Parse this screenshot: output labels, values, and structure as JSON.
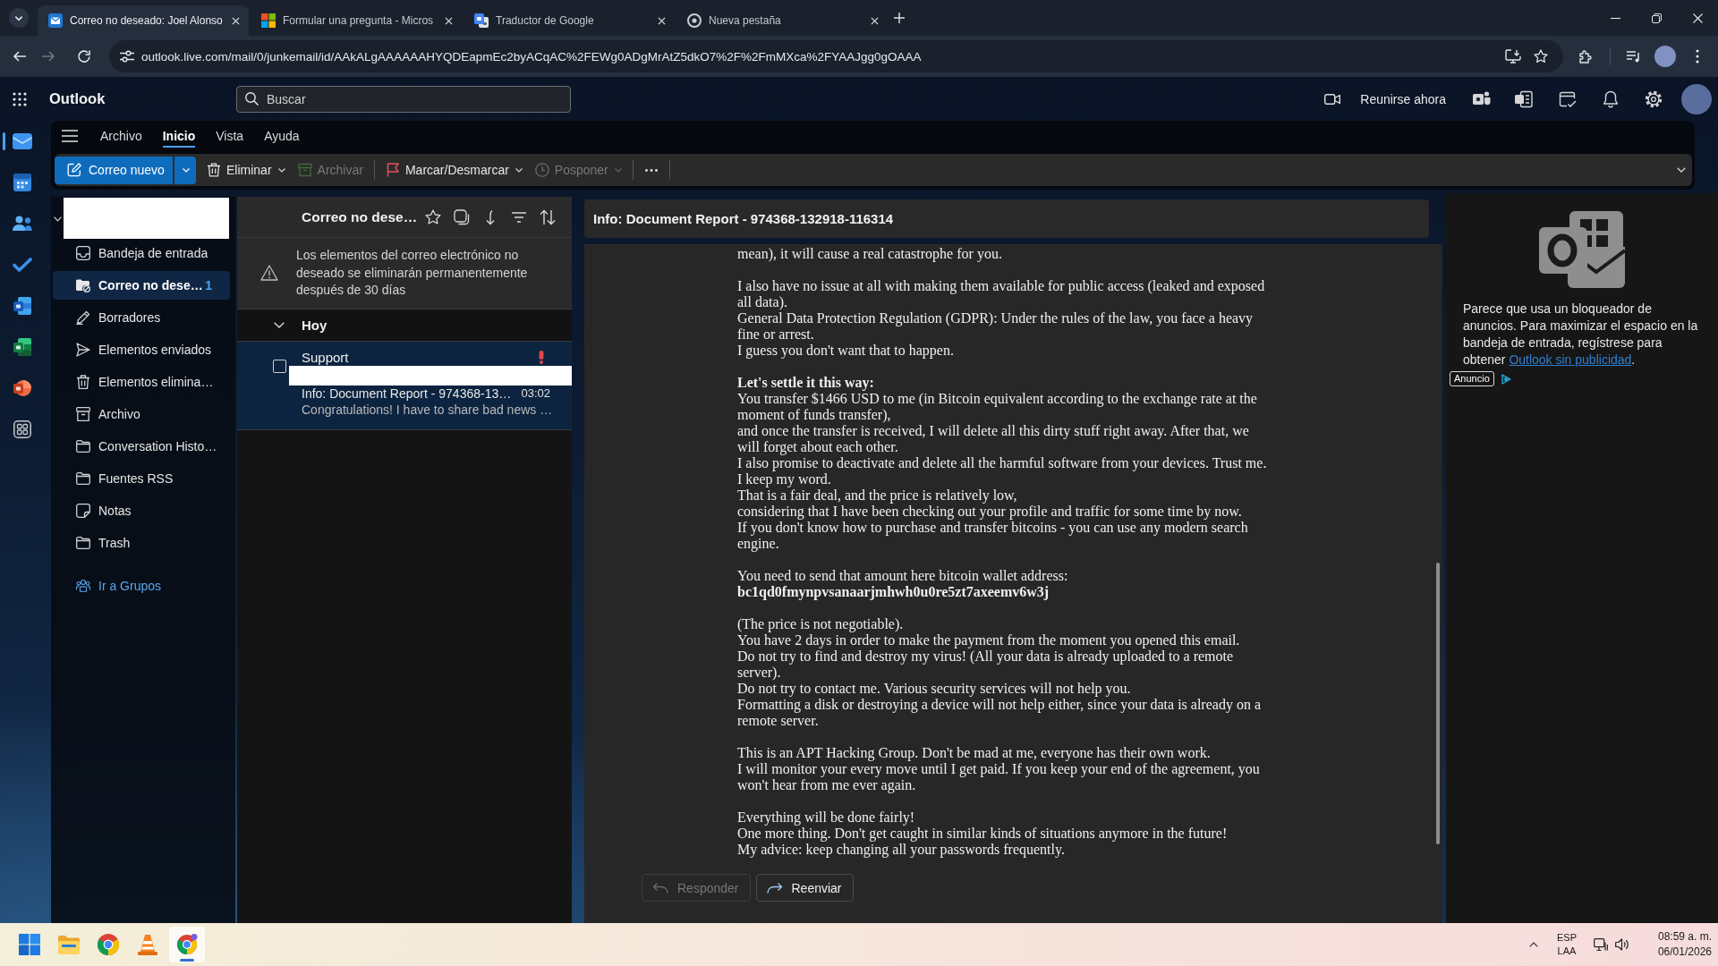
{
  "browser": {
    "tabs": [
      {
        "kind": "outlook",
        "title": "Correo no deseado: Joel Alonso",
        "selected": true
      },
      {
        "kind": "microsoft",
        "title": "Formular una pregunta - Micros",
        "selected": false
      },
      {
        "kind": "translate",
        "title": "Traductor de Google",
        "selected": false
      },
      {
        "kind": "newtab",
        "title": "Nueva pestaña",
        "selected": false
      }
    ],
    "address": "outlook.live.com/mail/0/junkemail/id/AAkALgAAAAAAHYQDEapmEc2byACqAC%2FEWg0ADgMrAtZ5dkO7%2F%2FmMXca%2FYAAJgg0gOAAA"
  },
  "header": {
    "app_name": "Outlook",
    "search": {
      "placeholder": "Buscar"
    },
    "meet_now": "Reunirse ahora"
  },
  "app_rail": [
    {
      "kind": "mail",
      "selected": true
    },
    {
      "kind": "calendar",
      "selected": false
    },
    {
      "kind": "people",
      "selected": false
    },
    {
      "kind": "todo",
      "selected": false
    },
    {
      "kind": "word",
      "selected": false
    },
    {
      "kind": "excel",
      "selected": false
    },
    {
      "kind": "powerpoint",
      "selected": false
    },
    {
      "kind": "apps",
      "selected": false
    }
  ],
  "ribbon": {
    "tabs": [
      {
        "label": "Archivo",
        "selected": false
      },
      {
        "label": "Inicio",
        "selected": true
      },
      {
        "label": "Vista",
        "selected": false
      },
      {
        "label": "Ayuda",
        "selected": false
      }
    ],
    "actions": [
      {
        "kind": "new-mail",
        "label": "Correo nuevo",
        "disabled": false,
        "dropdown": true,
        "separator_before": false
      },
      {
        "kind": "delete",
        "label": "Eliminar",
        "disabled": false,
        "dropdown": true,
        "separator_before": false
      },
      {
        "kind": "archive",
        "label": "Archivar",
        "disabled": true,
        "dropdown": false,
        "separator_before": false
      },
      {
        "kind": "flag",
        "label": "Marcar/Desmarcar",
        "disabled": false,
        "dropdown": true,
        "separator_before": true
      },
      {
        "kind": "snooze",
        "label": "Posponer",
        "disabled": true,
        "dropdown": true,
        "separator_before": false
      }
    ]
  },
  "folder_pane": {
    "account": {
      "redacted": true
    },
    "folders": [
      {
        "kind": "inbox",
        "label": "Bandeja de entrada",
        "selected": false
      },
      {
        "kind": "junk",
        "label": "Correo no dese…",
        "count": "1",
        "selected": true
      },
      {
        "kind": "drafts",
        "label": "Borradores",
        "selected": false
      },
      {
        "kind": "sent",
        "label": "Elementos enviados",
        "selected": false
      },
      {
        "kind": "deleted",
        "label": "Elementos elimina…",
        "selected": false
      },
      {
        "kind": "archive",
        "label": "Archivo",
        "selected": false
      },
      {
        "kind": "folder",
        "label": "Conversation Histo…",
        "selected": false
      },
      {
        "kind": "folder",
        "label": "Fuentes RSS",
        "selected": false
      },
      {
        "kind": "notes",
        "label": "Notas",
        "selected": false
      },
      {
        "kind": "folder",
        "label": "Trash",
        "selected": false
      }
    ],
    "groups_link": "Ir a Grupos"
  },
  "message_list": {
    "title": "Correo no dese…",
    "notice": "Los elementos del correo electrónico no deseado se eliminarán permanentemente después de 30 días",
    "groups": [
      {
        "label": "Hoy",
        "expanded": true,
        "messages": [
          {
            "sender": "Support",
            "redacted": true,
            "subject": "Info: Document Report - 974368-13…",
            "time": "03:02",
            "preview": "Congratulations! I have to share bad news …",
            "selected": true,
            "checked": false,
            "important": true
          }
        ]
      }
    ]
  },
  "reading_pane": {
    "subject": "Info: Document Report - 974368-132918-116314",
    "body": [
      {
        "lines": [
          "mean), it will cause a real catastrophe for you."
        ]
      },
      {
        "lines": [
          "I also have no issue at all with making them available for public access (leaked and exposed all data).",
          "General Data Protection Regulation (GDPR): Under the rules of the law, you face a heavy fine or arrest.",
          "I guess you don't want that to happen."
        ]
      },
      {
        "lines": [
          "**Let's settle it this way:**",
          "You transfer $1466 USD to me (in Bitcoin equivalent according to the exchange rate at the moment of funds transfer),",
          "and once the transfer is received, I will delete all this dirty stuff right away. After that, we will forget about each other.",
          "I also promise to deactivate and delete all the harmful software from your devices. Trust me. I keep my word.",
          "That is a fair deal, and the price is relatively low,",
          "considering that I have been checking out your profile and traffic for some time by now.",
          "If you don't know how to purchase and transfer bitcoins - you can use any modern search engine."
        ]
      },
      {
        "lines": [
          "You need to send that amount here bitcoin wallet address:",
          "**bc1qd0fmynpvsanaarjmhwh0u0re5zt7axeemv6w3j**"
        ]
      },
      {
        "lines": [
          "(The price is not negotiable).",
          "You have 2 days in order to make the payment from the moment you opened this email.",
          "Do not try to find and destroy my virus! (All your data is already uploaded to a remote server).",
          "Do not try to contact me. Various security services will not help you.",
          "Formatting a disk or destroying a device will not help either, since your data is already on a remote server."
        ]
      },
      {
        "lines": [
          "This is an APT Hacking Group. Don't be mad at me, everyone has their own work.",
          "I will monitor your every move until I get paid. If you keep your end of the agreement, you won't hear from me ever again."
        ]
      },
      {
        "lines": [
          "Everything will be done fairly!",
          "One more thing. Don't get caught in similar kinds of situations anymore in the future!",
          "My advice: keep changing all your passwords frequently."
        ]
      }
    ],
    "actions": [
      {
        "kind": "reply",
        "label": "Responder",
        "disabled": true
      },
      {
        "kind": "forward",
        "label": "Reenviar",
        "disabled": false
      }
    ]
  },
  "ad_pane": {
    "text": "Parece que usa un bloqueador de anuncios. Para maximizar el espacio en la bandeja de entrada, regístrese para obtener",
    "link": "Outlook sin publicidad",
    "text_end": ".",
    "badge": "Anuncio"
  },
  "taskbar": {
    "apps": [
      {
        "kind": "start",
        "active": false
      },
      {
        "kind": "explorer",
        "active": false
      },
      {
        "kind": "chrome",
        "active": false
      },
      {
        "kind": "vlc",
        "active": false
      },
      {
        "kind": "chrome",
        "active": true
      }
    ],
    "language": [
      "ESP",
      "LAA"
    ],
    "time": "08:59 a. m.",
    "date": "06/01/2026"
  }
}
